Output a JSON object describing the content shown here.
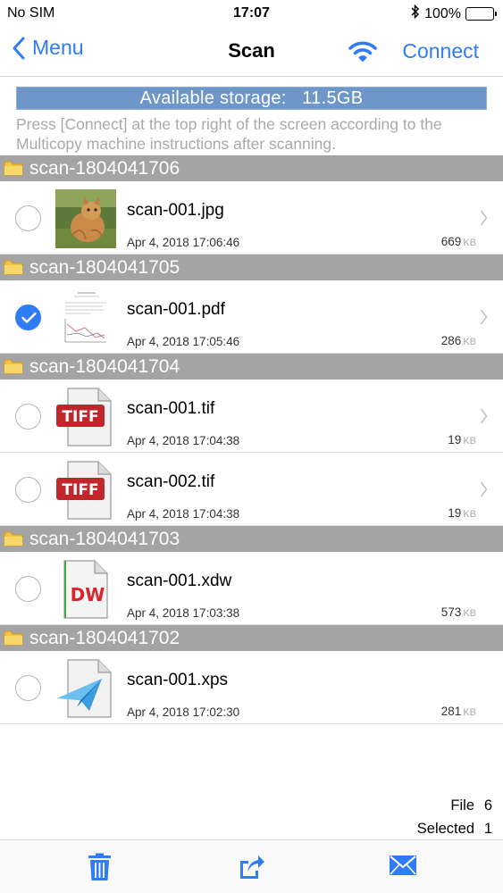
{
  "status": {
    "carrier": "No SIM",
    "time": "17:07",
    "battery": "100%"
  },
  "nav": {
    "back_label": "Menu",
    "title": "Scan",
    "connect_label": "Connect"
  },
  "storage": {
    "label": "Available storage:",
    "value": "11.5GB"
  },
  "instructions": "Press [Connect] at the top right of the screen according to the Multicopy machine instructions after scanning.",
  "groups": [
    {
      "name": "scan-1804041706",
      "files": [
        {
          "name": "scan-001.jpg",
          "date": "Apr 4, 2018 17:06:46",
          "size": "669",
          "unit": "KB",
          "type": "jpg",
          "selected": false
        }
      ]
    },
    {
      "name": "scan-1804041705",
      "files": [
        {
          "name": "scan-001.pdf",
          "date": "Apr 4, 2018 17:05:46",
          "size": "286",
          "unit": "KB",
          "type": "pdf",
          "selected": true
        }
      ]
    },
    {
      "name": "scan-1804041704",
      "files": [
        {
          "name": "scan-001.tif",
          "date": "Apr 4, 2018 17:04:38",
          "size": "19",
          "unit": "KB",
          "type": "tif",
          "selected": false,
          "badge": "TIFF"
        },
        {
          "name": "scan-002.tif",
          "date": "Apr 4, 2018 17:04:38",
          "size": "19",
          "unit": "KB",
          "type": "tif",
          "selected": false,
          "badge": "TIFF"
        }
      ]
    },
    {
      "name": "scan-1804041703",
      "files": [
        {
          "name": "scan-001.xdw",
          "date": "Apr 4, 2018 17:03:38",
          "size": "573",
          "unit": "KB",
          "type": "xdw",
          "selected": false,
          "badge": "DW"
        }
      ]
    },
    {
      "name": "scan-1804041702",
      "files": [
        {
          "name": "scan-001.xps",
          "date": "Apr 4, 2018 17:02:30",
          "size": "281",
          "unit": "KB",
          "type": "xps",
          "selected": false
        }
      ]
    }
  ],
  "counts": {
    "file_label": "File",
    "file_count": "6",
    "selected_label": "Selected",
    "selected_count": "1"
  },
  "toolbar": {
    "icons": [
      "trash-icon",
      "share-icon",
      "mail-icon"
    ]
  },
  "colors": {
    "accent": "#2f7cf6",
    "group_header": "#a4a4a4",
    "storage_bar": "#6e96c8",
    "tiff_badge": "#c0262c"
  }
}
